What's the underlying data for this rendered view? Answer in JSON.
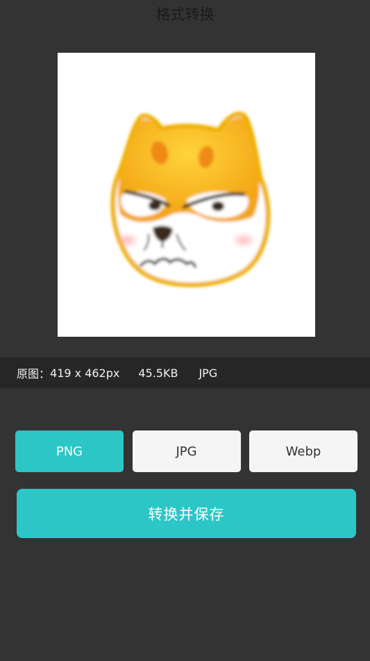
{
  "header": {
    "title": "格式转换"
  },
  "image_info": {
    "label": "原图：",
    "dimensions": "419 x 462px",
    "file_size": "45.5KB",
    "file_type": "JPG"
  },
  "formats": {
    "options": [
      "PNG",
      "JPG",
      "Webp"
    ],
    "selected": "PNG"
  },
  "actions": {
    "convert_label": "转换并保存"
  },
  "colors": {
    "background": "#333333",
    "accent": "#2cc6c6",
    "info_bar": "#262626",
    "button_inactive": "#f5f5f5"
  }
}
